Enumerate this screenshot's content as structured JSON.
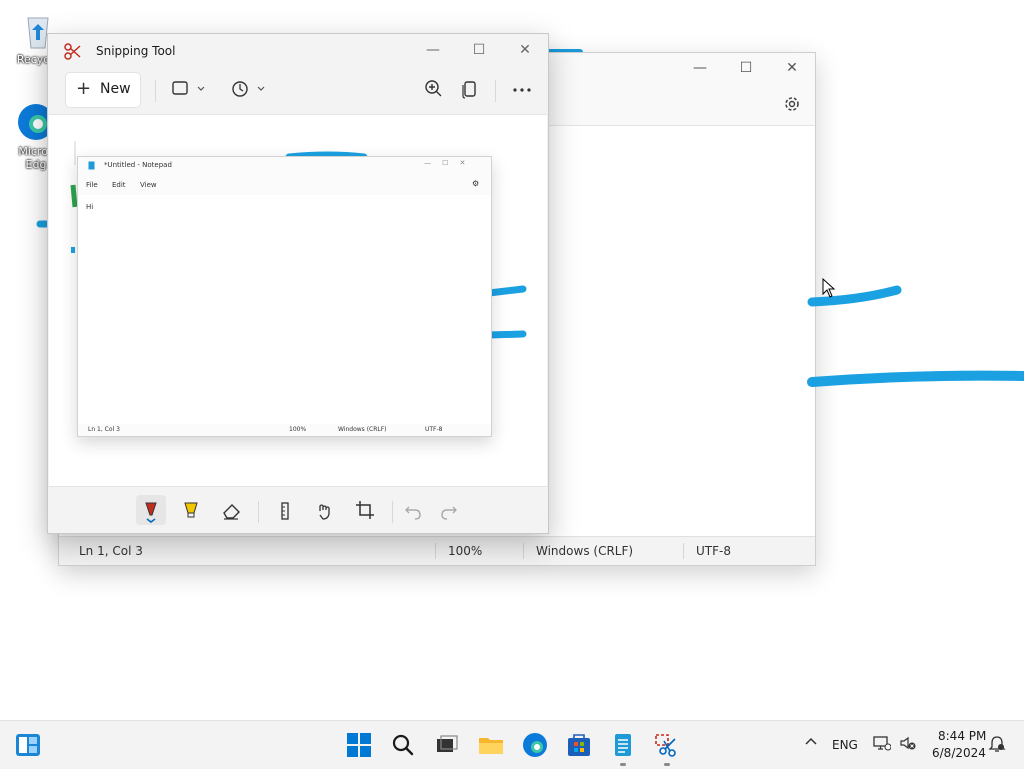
{
  "desktop": {
    "icons": [
      {
        "label": "Recycle"
      },
      {
        "label": "Micros"
      },
      {
        "label": "Edg"
      }
    ]
  },
  "notepad": {
    "status": {
      "position": "Ln 1, Col 3",
      "zoom": "100%",
      "line_ending": "Windows (CRLF)",
      "encoding": "UTF-8"
    }
  },
  "snipping_tool": {
    "title": "Snipping Tool",
    "new_label": "New",
    "capture": {
      "title": "*Untitled - Notepad",
      "menu": [
        "File",
        "Edit",
        "View"
      ],
      "text": "Hi",
      "status": {
        "position": "Ln 1, Col 3",
        "zoom": "100%",
        "line_ending": "Windows (CRLF)",
        "encoding": "UTF-8"
      }
    }
  },
  "taskbar": {
    "language": "ENG",
    "time": "8:44 PM",
    "date": "6/8/2024"
  },
  "colors": {
    "ink": "#1ba1e2",
    "accent": "#0067c0",
    "pen": "#c42b1c",
    "highlighter": "#f2c600"
  }
}
